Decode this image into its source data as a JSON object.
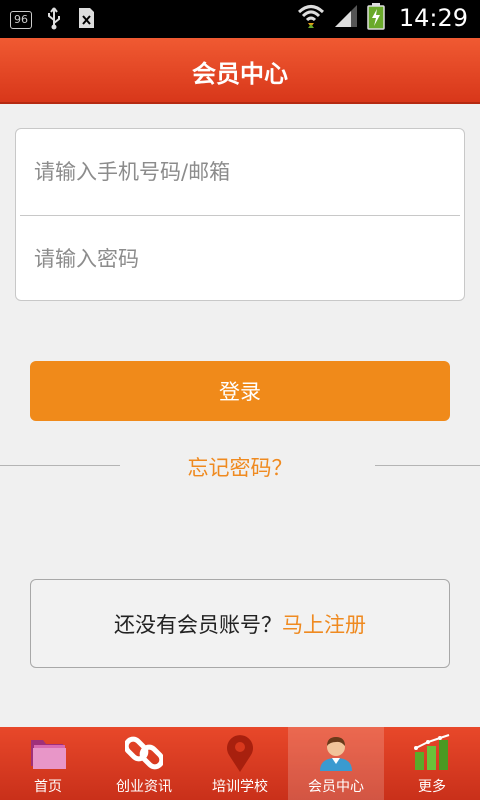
{
  "status_bar": {
    "notification_badge": "96",
    "time": "14:29"
  },
  "header": {
    "title": "会员中心"
  },
  "login_form": {
    "account_placeholder": "请输入手机号码/邮箱",
    "password_placeholder": "请输入密码",
    "login_button": "登录",
    "forgot_password": "忘记密码？"
  },
  "register": {
    "prompt": "还没有会员账号？",
    "link": "马上注册"
  },
  "tabs": [
    {
      "label": "首页",
      "icon": "folder-icon"
    },
    {
      "label": "创业资讯",
      "icon": "link-icon"
    },
    {
      "label": "培训学校",
      "icon": "map-pin-icon"
    },
    {
      "label": "会员中心",
      "icon": "user-icon",
      "active": true
    },
    {
      "label": "更多",
      "icon": "bar-chart-icon"
    }
  ],
  "colors": {
    "header": "#e2452a",
    "accent_orange": "#f08a1a",
    "link_orange": "#ef8a20",
    "tabbar": "#d8381d"
  }
}
